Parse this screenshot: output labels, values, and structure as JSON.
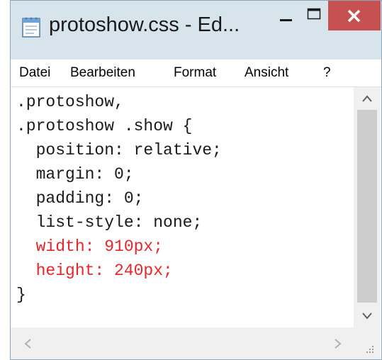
{
  "window": {
    "title": "protoshow.css - Ed...",
    "menu": [
      "Datei",
      "Bearbeiten",
      "Format",
      "Ansicht",
      "?"
    ]
  },
  "editor": {
    "lines": [
      {
        "text": ".protoshow,",
        "color": "#1a1a1a"
      },
      {
        "text": ".protoshow .show {",
        "color": "#1a1a1a"
      },
      {
        "text": "  position: relative;",
        "color": "#1a1a1a"
      },
      {
        "text": "  margin: 0;",
        "color": "#1a1a1a"
      },
      {
        "text": "  padding: 0;",
        "color": "#1a1a1a"
      },
      {
        "text": "  list-style: none;",
        "color": "#1a1a1a"
      },
      {
        "text": "  width: 910px;",
        "color": "#e8252a"
      },
      {
        "text": "  height: 240px;",
        "color": "#e8252a"
      },
      {
        "text": "}",
        "color": "#1a1a1a"
      }
    ]
  },
  "colors": {
    "titlebar": "#d8e4ec",
    "close_button": "#c75050",
    "highlight_text": "#e8252a"
  },
  "icons": [
    "notepad-icon",
    "minimize-icon",
    "maximize-icon",
    "close-icon",
    "scroll-up-icon",
    "scroll-down-icon",
    "scroll-left-icon",
    "scroll-right-icon",
    "resize-grip-icon"
  ]
}
